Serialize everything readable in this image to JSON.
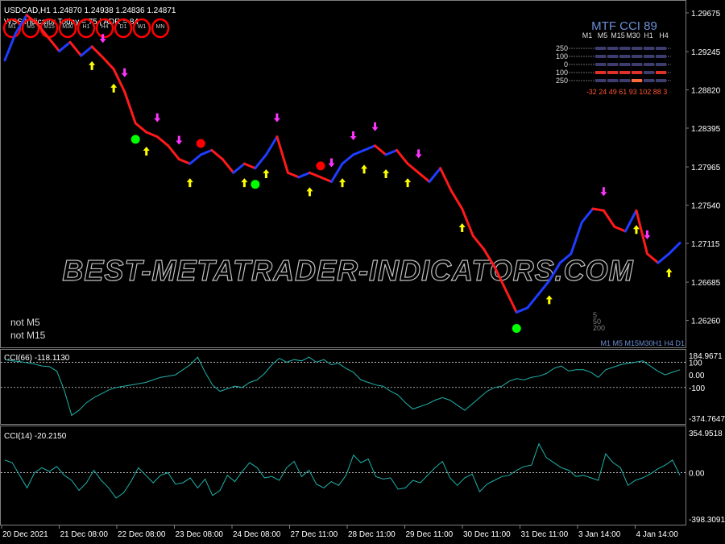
{
  "header": {
    "symbol_line": "USDCAD,H1  1.24870 1.24938 1.24836 1.24871",
    "indicator_line": "WSS Indicator Today = 75   |   ADR = 84",
    "tf_circles": [
      "M1",
      "M5",
      "M15",
      "M30",
      "H1",
      "H4",
      "D1",
      "W1",
      "MN"
    ]
  },
  "watermark": "BEST-METATRADER-INDICATORS.COM",
  "mtf_panel": {
    "title": "MTF CCI  89",
    "headers": [
      "M1",
      "M5",
      "M15",
      "M30",
      "H1",
      "H4"
    ],
    "levels": [
      "250",
      "100",
      "0",
      "100",
      "250"
    ],
    "values_line": "-32 24 49 61 93 102 88 3",
    "bottom_tfs": "M1  M5  M15M30H1  H4  D1"
  },
  "notes": [
    "not M5",
    "not M15"
  ],
  "small_numbers": [
    "5",
    "50",
    "200"
  ],
  "colors": {
    "bull": "#1f3dff",
    "bear": "#ff1a1a",
    "grid": "#7f7f7f",
    "cci_line": "#20b2aa",
    "buy_arrow": "#ffff00",
    "sell_arrow": "#ff33ff",
    "green_dot": "#00ff00",
    "red_dot": "#ff0000"
  },
  "chart_data": [
    {
      "type": "line",
      "title": "USDCAD,H1",
      "x_ticks": [
        "20 Dec 2021",
        "21 Dec 08:00",
        "22 Dec 08:00",
        "23 Dec 08:00",
        "24 Dec 08:00",
        "27 Dec 11:00",
        "28 Dec 11:00",
        "29 Dec 11:00",
        "30 Dec 11:00",
        "31 Dec 11:00",
        "3 Jan 14:00",
        "4 Jan 14:00"
      ],
      "y_ticks": [
        "1.29675",
        "1.29245",
        "1.28820",
        "1.28395",
        "1.27965",
        "1.27540",
        "1.27115",
        "1.26685",
        "1.26260"
      ],
      "ylim": [
        1.2597,
        1.298
      ],
      "series": [
        {
          "values": [
            1.2915,
            1.2945,
            1.2965,
            1.2955,
            1.294,
            1.2925,
            1.2935,
            1.292,
            1.293,
            1.2918,
            1.2905,
            1.288,
            1.2845,
            1.2835,
            1.283,
            1.282,
            1.2805,
            1.28,
            1.281,
            1.2815,
            1.2805,
            1.279,
            1.28,
            1.2795,
            1.281,
            1.283,
            1.279,
            1.2785,
            1.279,
            1.2785,
            1.278,
            1.28,
            1.281,
            1.2815,
            1.282,
            1.281,
            1.2815,
            1.28,
            1.279,
            1.278,
            1.2795,
            1.277,
            1.275,
            1.272,
            1.2705,
            1.2685,
            1.266,
            1.2635,
            1.264,
            1.2655,
            1.267,
            1.269,
            1.27,
            1.2735,
            1.275,
            1.2748,
            1.273,
            1.2725,
            1.2748,
            1.27,
            1.269,
            1.27,
            1.2712
          ]
        }
      ],
      "buy_arrows_at": [
        8,
        10,
        13,
        17,
        22,
        24,
        28,
        31,
        33,
        35,
        37,
        42,
        50,
        58,
        61
      ],
      "sell_arrows_at": [
        9,
        11,
        14,
        16,
        25,
        30,
        32,
        34,
        38,
        55,
        59
      ],
      "green_dots_at": [
        12,
        23,
        47
      ],
      "red_dots_at": [
        18,
        29
      ]
    },
    {
      "type": "line",
      "title": "CCI(66) -118.1130",
      "y_ticks": [
        "184.9671",
        "100",
        "0.00",
        "-100",
        "-374.7647"
      ],
      "ylim": [
        -374.7647,
        184.9671
      ],
      "levels": [
        100,
        -100
      ],
      "values": [
        120,
        110,
        105,
        95,
        85,
        70,
        65,
        30,
        -120,
        -320,
        -280,
        -220,
        -180,
        -150,
        -120,
        -100,
        -90,
        -80,
        -70,
        -60,
        -40,
        -20,
        -10,
        0,
        40,
        80,
        140,
        20,
        -80,
        -130,
        -110,
        -90,
        -100,
        -60,
        -40,
        10,
        80,
        130,
        100,
        120,
        110,
        140,
        100,
        120,
        80,
        90,
        50,
        20,
        -40,
        -60,
        -80,
        -90,
        -130,
        -160,
        -220,
        -270,
        -250,
        -230,
        -200,
        -180,
        -200,
        -240,
        -280,
        -230,
        -180,
        -130,
        -100,
        -90,
        -50,
        -30,
        -40,
        -20,
        -10,
        10,
        50,
        70,
        30,
        40,
        40,
        20,
        -20,
        40,
        60,
        80,
        90,
        100,
        110,
        70,
        30,
        0,
        20,
        40
      ]
    },
    {
      "type": "line",
      "title": "CCI(14) -20.2150",
      "y_ticks": [
        "354.9518",
        "0.00",
        "-398.3091"
      ],
      "ylim": [
        -398.3091,
        354.9518
      ],
      "levels": [
        0
      ],
      "values": [
        100,
        80,
        -20,
        -120,
        0,
        40,
        10,
        50,
        -20,
        -60,
        -140,
        -80,
        20,
        -60,
        -120,
        -200,
        -160,
        -70,
        40,
        -20,
        -80,
        -20,
        0,
        -90,
        -80,
        -40,
        -120,
        -50,
        -180,
        -140,
        -20,
        -70,
        10,
        80,
        40,
        -40,
        -30,
        -60,
        40,
        90,
        -30,
        20,
        -90,
        -120,
        -70,
        -100,
        -20,
        140,
        80,
        110,
        -30,
        -50,
        -40,
        -130,
        -120,
        -60,
        -80,
        -20,
        40,
        90,
        -40,
        -100,
        -40,
        -10,
        -150,
        -90,
        -60,
        -30,
        -20,
        20,
        50,
        60,
        230,
        120,
        80,
        40,
        20,
        -30,
        -20,
        -40,
        -60,
        150,
        80,
        40,
        -100,
        -60,
        -40,
        -10,
        30,
        60,
        100,
        -20
      ]
    }
  ]
}
